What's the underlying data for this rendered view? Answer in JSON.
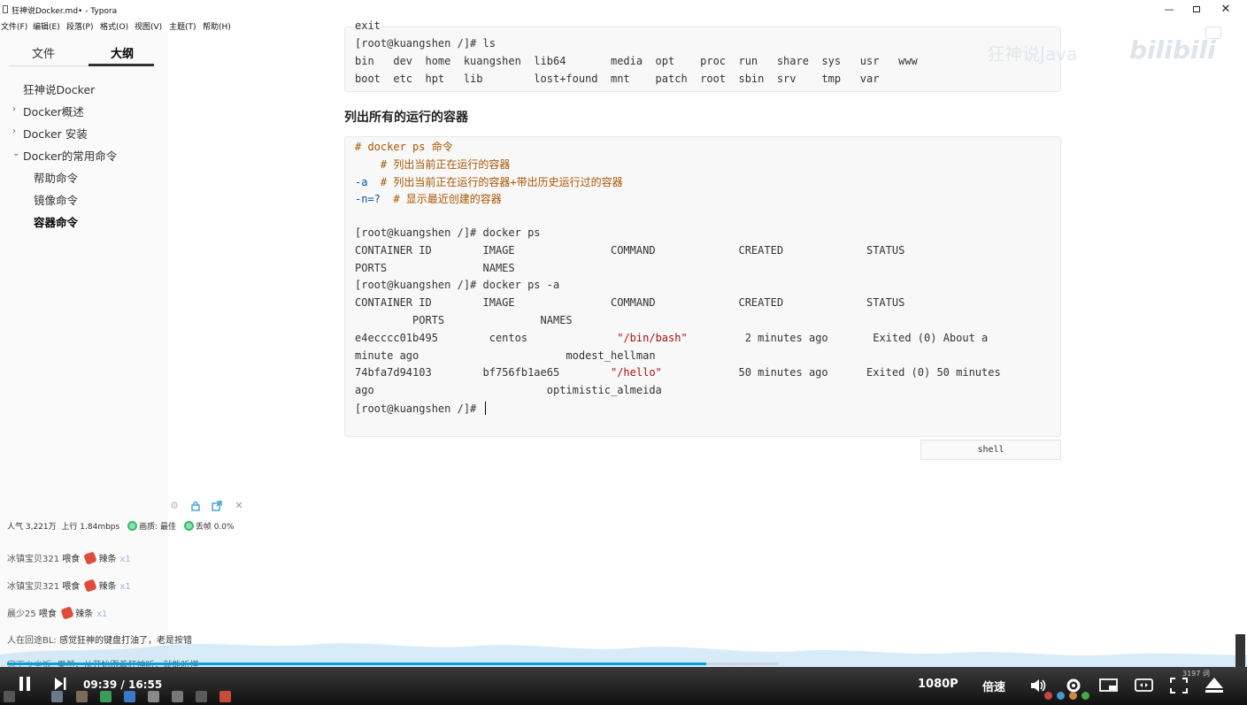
{
  "window": {
    "title": "狂神说Docker.md• - Typora",
    "minimize_symbol": "—",
    "close_symbol": "✕"
  },
  "menu": [
    "文件(F)",
    "编辑(E)",
    "段落(P)",
    "格式(O)",
    "视图(V)",
    "主题(T)",
    "帮助(H)"
  ],
  "sidebar": {
    "tab_files": "文件",
    "tab_outline": "大纲",
    "outline": [
      {
        "label": "狂神说Docker",
        "level": 0,
        "chevron": ""
      },
      {
        "label": "Docker概述",
        "level": 0,
        "chevron": "›"
      },
      {
        "label": "Docker 安装",
        "level": 0,
        "chevron": "›"
      },
      {
        "label": "Docker的常用命令",
        "level": 0,
        "chevron": "⌄"
      },
      {
        "label": "帮助命令",
        "level": 1,
        "chevron": ""
      },
      {
        "label": "镜像命令",
        "level": 1,
        "chevron": ""
      },
      {
        "label": "容器命令",
        "level": 1,
        "chevron": "",
        "active": true
      }
    ]
  },
  "code_block_1": {
    "lines": [
      "exit",
      "[root@kuangshen /]# ls",
      "bin   dev  home  kuangshen  lib64       media  opt    proc  run   share  sys   usr   www",
      "boot  etc  hpt   lib        lost+found  mnt    patch  root  sbin  srv    tmp   var"
    ]
  },
  "section_heading": "列出所有的运行的容器",
  "code_block_2": {
    "lines": [
      [
        {
          "t": "# docker ps 命令",
          "c": "comment"
        }
      ],
      [
        {
          "t": "    # 列出当前正在运行的容器",
          "c": "comment"
        }
      ],
      [
        {
          "t": "-a",
          "c": "flag"
        },
        {
          "t": "  # 列出当前正在运行的容器+带出历史运行过的容器",
          "c": "comment"
        }
      ],
      [
        {
          "t": "-n=?",
          "c": "flag"
        },
        {
          "t": "  # 显示最近创建的容器",
          "c": "comment"
        }
      ],
      [
        {
          "t": "",
          "c": ""
        }
      ],
      [
        {
          "t": "[root@kuangshen /]# docker ps",
          "c": ""
        }
      ],
      [
        {
          "t": "CONTAINER ID        IMAGE               COMMAND             CREATED             STATUS",
          "c": ""
        }
      ],
      [
        {
          "t": "PORTS               NAMES",
          "c": ""
        }
      ],
      [
        {
          "t": "[root@kuangshen /]# docker ps -a",
          "c": ""
        }
      ],
      [
        {
          "t": "CONTAINER ID        IMAGE               COMMAND             CREATED             STATUS",
          "c": ""
        }
      ],
      [
        {
          "t": "         PORTS               NAMES",
          "c": ""
        }
      ],
      [
        {
          "t": "e4ecccc01b495        centos              ",
          "c": ""
        },
        {
          "t": "\"/bin/bash\"",
          "c": "string"
        },
        {
          "t": "         2 minutes ago       Exited (0) About a",
          "c": ""
        }
      ],
      [
        {
          "t": "minute ago                       modest_hellman",
          "c": ""
        }
      ],
      [
        {
          "t": "74bfa7d94103        bf756fb1ae65        ",
          "c": ""
        },
        {
          "t": "\"/hello\"",
          "c": "string"
        },
        {
          "t": "            50 minutes ago      Exited (0) 50 minutes",
          "c": ""
        }
      ],
      [
        {
          "t": "ago                           optimistic_almeida",
          "c": ""
        }
      ],
      [
        {
          "t": "[root@kuangshen /]# ",
          "c": ""
        }
      ]
    ],
    "language": "shell"
  },
  "watermark": {
    "text": "狂神说Java",
    "logo": "bilibili"
  },
  "danmaku_stats": {
    "popularity_label": "人气",
    "popularity": "3,221万",
    "upload_label": "上行",
    "upload": "1.84mbps",
    "quality_label": "画质: 最佳",
    "loss_label": "丢帧 0.0%"
  },
  "gift_messages": [
    {
      "user": "冰镇宝贝321",
      "action": "喂食",
      "gift": "辣条",
      "count": "x1"
    },
    {
      "user": "冰镇宝贝321",
      "action": "喂食",
      "gift": "辣条",
      "count": "x1"
    },
    {
      "user": "晨少25",
      "action": "喂食",
      "gift": "辣条",
      "count": "x1"
    }
  ],
  "chat_messages": [
    {
      "user": "人在回途BL:",
      "text": "感觉狂神的键盘打油了，老是按错"
    },
    {
      "user": "宫下少尘饭:",
      "text": "果然，从开始跟着狂神听，就能听懂"
    }
  ],
  "player": {
    "current_time": "09:39",
    "separator": "/",
    "total_time": "16:55",
    "progress": 0.906,
    "quality": "1080P",
    "speed": "倍速"
  },
  "word_count": "3197 词",
  "colors": {
    "accent": "#00a1d6",
    "comment": "#aa5500",
    "flag": "#0055aa",
    "string": "#aa1111"
  }
}
